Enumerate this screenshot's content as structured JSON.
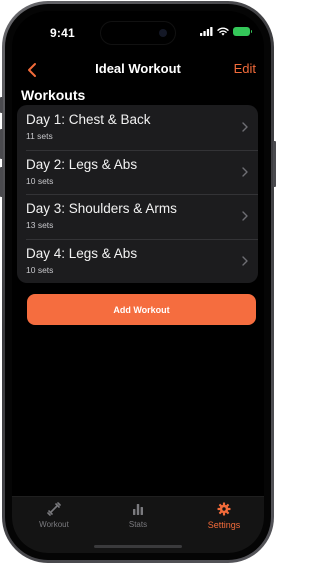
{
  "status_bar": {
    "time": "9:41"
  },
  "nav": {
    "back_icon": "chevron-left-icon",
    "title": "Ideal Workout",
    "edit_label": "Edit"
  },
  "section": {
    "title": "Workouts"
  },
  "workouts": [
    {
      "title": "Day 1: Chest & Back",
      "sets": "11 sets"
    },
    {
      "title": "Day 2: Legs & Abs",
      "sets": "10 sets"
    },
    {
      "title": "Day 3: Shoulders & Arms",
      "sets": "13 sets"
    },
    {
      "title": "Day 4: Legs & Abs",
      "sets": "10 sets"
    }
  ],
  "add_button": {
    "label": "Add Workout"
  },
  "tabs": [
    {
      "label": "Workout",
      "icon": "dumbbell-icon",
      "active": false
    },
    {
      "label": "Stats",
      "icon": "bar-chart-icon",
      "active": false
    },
    {
      "label": "Settings",
      "icon": "gear-icon",
      "active": true
    }
  ],
  "colors": {
    "accent": "#f26b3a",
    "button": "#f56d3f",
    "background": "#000000",
    "list_background": "#1c1c1e",
    "battery": "#34c759"
  }
}
